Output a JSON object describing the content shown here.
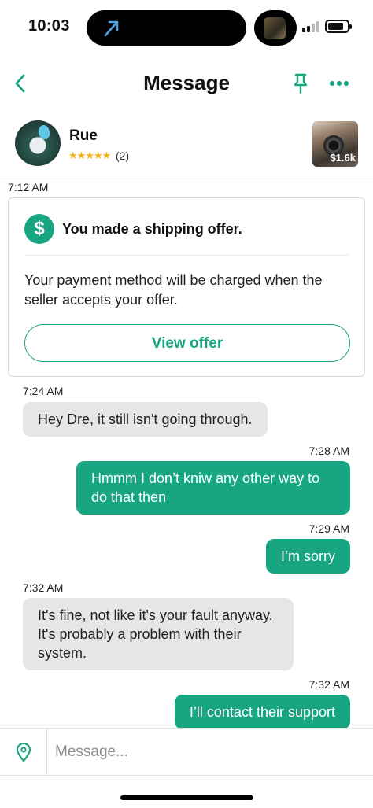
{
  "status_bar": {
    "time": "10:03"
  },
  "header": {
    "title": "Message"
  },
  "seller": {
    "name": "Rue",
    "stars": "★★★★★",
    "review_count": "(2)",
    "item_price": "$1.6k"
  },
  "messages": {
    "t0": "7:12 AM",
    "offer": {
      "title": "You made a shipping offer.",
      "body": "Your payment method will be charged when the seller accepts your offer.",
      "button_label": "View offer"
    },
    "t1": "7:24 AM",
    "m1": "Hey Dre, it still isn't going through.",
    "t2": "7:28 AM",
    "m2": "Hmmm I don’t kniw any other way to do that then",
    "t3": "7:29 AM",
    "m3": "I’m sorry",
    "t4": "7:32 AM",
    "m4": "It's fine, not like it's your fault anyway. It's probably a problem with their system.",
    "t5": "7:32 AM",
    "m5": "I’ll contact their support"
  },
  "compose": {
    "placeholder": "Message..."
  },
  "colors": {
    "accent": "#17a582",
    "incoming_bubble": "#e6e6e6"
  },
  "icons": [
    "back-icon",
    "pin-icon",
    "more-icon",
    "dollar-icon",
    "location-icon"
  ]
}
